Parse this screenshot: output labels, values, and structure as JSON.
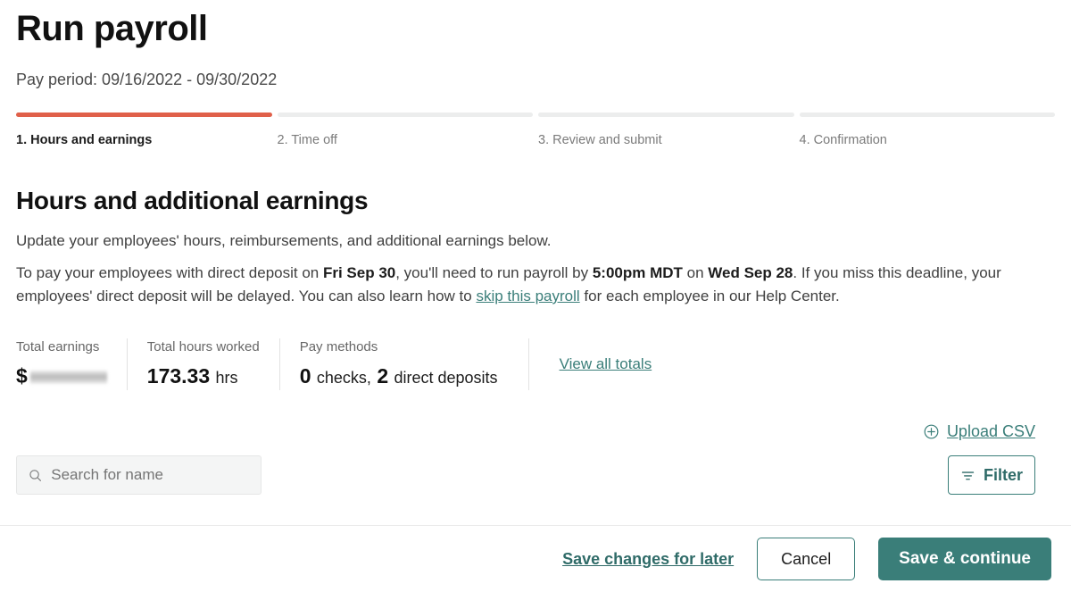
{
  "header": {
    "title": "Run payroll",
    "pay_period_label": "Pay period:",
    "pay_period_value": "09/16/2022 - 09/30/2022",
    "pay_period_full": "Pay period: 09/16/2022 - 09/30/2022"
  },
  "colors": {
    "accent_teal": "#3a7e79",
    "progress_red": "#e0604a",
    "text_dark": "#111111",
    "text_muted": "#7b7b7b",
    "track_grey": "#eceded"
  },
  "stepper": {
    "active_index": 0,
    "steps": [
      {
        "label": "1. Hours and earnings",
        "state": "active"
      },
      {
        "label": "2. Time off",
        "state": "upcoming"
      },
      {
        "label": "3. Review and submit",
        "state": "upcoming"
      },
      {
        "label": "4. Confirmation",
        "state": "upcoming"
      }
    ]
  },
  "section": {
    "title": "Hours and additional earnings",
    "subtitle": "Update your employees' hours, reimbursements, and additional earnings below.",
    "deadline": {
      "part1": "To pay your employees with direct deposit on ",
      "bold1": "Fri Sep 30",
      "part2": ", you'll need to run payroll by ",
      "bold2": "5:00pm MDT",
      "part3": " on ",
      "bold3": "Wed Sep 28",
      "part4": ". If you miss this deadline, your employees' direct deposit will be delayed. You can also learn how to ",
      "link": "skip this payroll",
      "part5": " for each employee in our Help Center."
    }
  },
  "totals": {
    "earnings": {
      "label": "Total earnings",
      "currency_symbol": "$",
      "value": "",
      "redacted": true
    },
    "hours": {
      "label": "Total hours worked",
      "value": "173.33",
      "unit": "hrs"
    },
    "pay_methods": {
      "label": "Pay methods",
      "checks_count": "0",
      "checks_unit": "checks,",
      "deposits_count": "2",
      "deposits_unit": "direct deposits"
    },
    "view_all_link": "View all totals"
  },
  "upload": {
    "label": "Upload CSV",
    "icon": "plus-circle-icon"
  },
  "search": {
    "placeholder": "Search for name",
    "value": "",
    "icon": "search-icon"
  },
  "filter": {
    "label": "Filter",
    "icon": "filter-icon"
  },
  "footer": {
    "save_later_label": "Save changes for later",
    "cancel_label": "Cancel",
    "continue_label": "Save & continue"
  }
}
